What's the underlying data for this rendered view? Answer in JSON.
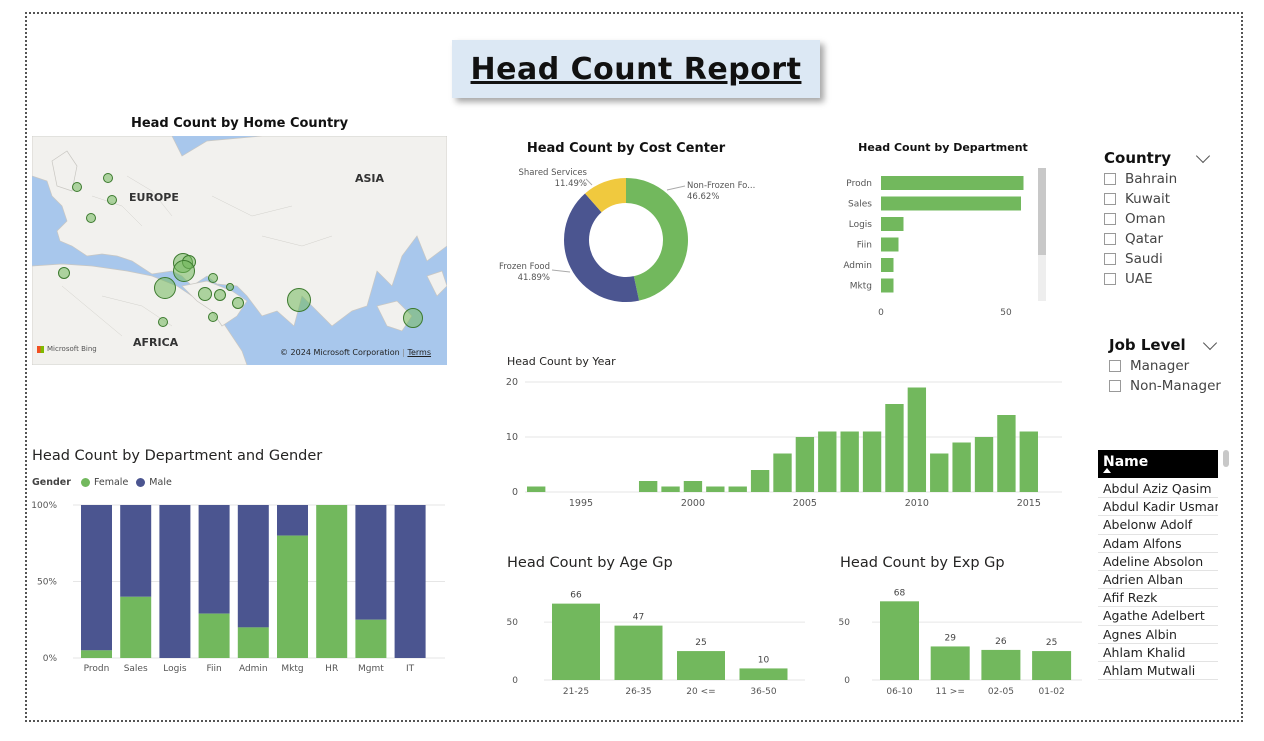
{
  "report": {
    "title": "Head Count Report"
  },
  "colors": {
    "green": "#72b85d",
    "navy": "#4b5590",
    "yellow": "#f0c93e",
    "map_water": "#a8c7ec",
    "map_land": "#f2f1ee"
  },
  "map_visual": {
    "title": "Head Count by Home Country",
    "labels": {
      "europe": "EUROPE",
      "asia": "ASIA",
      "africa": "AFRICA"
    },
    "attribution": "© 2024 Microsoft Corporation",
    "terms": "Terms",
    "logo_text": "Microsoft Bing"
  },
  "chart_data": [
    {
      "id": "cost_center",
      "type": "pie",
      "title": "Head Count by Cost Center",
      "categories": [
        "Non-Frozen Fo...",
        "Frozen Food",
        "Shared Services"
      ],
      "values": [
        46.62,
        41.89,
        11.49
      ],
      "labels": [
        "46.62%",
        "41.89%",
        "11.49%"
      ]
    },
    {
      "id": "department",
      "type": "bar",
      "orientation": "horizontal",
      "title": "Head Count by Department",
      "categories": [
        "Prodn",
        "Sales",
        "Logis",
        "Fiin",
        "Admin",
        "Mktg"
      ],
      "values": [
        57,
        56,
        9,
        7,
        5,
        5
      ],
      "xticks": [
        "0",
        "50"
      ],
      "xlim": [
        0,
        60
      ]
    },
    {
      "id": "year",
      "type": "bar",
      "title": "Head Count by Year",
      "x": [
        1993,
        1994,
        1995,
        1996,
        1997,
        1998,
        1999,
        2000,
        2001,
        2002,
        2003,
        2004,
        2005,
        2006,
        2007,
        2008,
        2009,
        2010,
        2011,
        2012,
        2013,
        2014,
        2015
      ],
      "values": [
        1,
        0,
        0,
        0,
        0,
        2,
        1,
        2,
        1,
        1,
        4,
        7,
        10,
        11,
        11,
        11,
        16,
        19,
        7,
        9,
        10,
        14,
        11
      ],
      "xticks": [
        "1995",
        "2000",
        "2005",
        "2010",
        "2015"
      ],
      "yticks": [
        "0",
        "10",
        "20"
      ],
      "ylim": [
        0,
        20
      ]
    },
    {
      "id": "dept_gender",
      "type": "bar",
      "stacked": "100%",
      "title": "Head Count by Department and Gender",
      "legend_title": "Gender",
      "categories": [
        "Prodn",
        "Sales",
        "Logis",
        "Fiin",
        "Admin",
        "Mktg",
        "HR",
        "Mgmt",
        "IT"
      ],
      "series": [
        {
          "name": "Female",
          "values": [
            5,
            40,
            0,
            29,
            20,
            80,
            100,
            25,
            0
          ]
        },
        {
          "name": "Male",
          "values": [
            95,
            60,
            100,
            71,
            80,
            20,
            0,
            75,
            100
          ]
        }
      ],
      "yticks": [
        "0%",
        "50%",
        "100%"
      ],
      "ylim": [
        0,
        100
      ]
    },
    {
      "id": "age_gp",
      "type": "bar",
      "title": "Head Count by Age Gp",
      "categories": [
        "21-25",
        "26-35",
        "20 <=",
        "36-50"
      ],
      "values": [
        66,
        47,
        25,
        10
      ],
      "yticks": [
        "0",
        "50"
      ],
      "ylim": [
        0,
        70
      ]
    },
    {
      "id": "exp_gp",
      "type": "bar",
      "title": "Head Count by Exp Gp",
      "categories": [
        "06-10",
        "11 >=",
        "02-05",
        "01-02"
      ],
      "values": [
        68,
        29,
        26,
        25
      ],
      "yticks": [
        "0",
        "50"
      ],
      "ylim": [
        0,
        70
      ]
    }
  ],
  "slicers": {
    "country": {
      "title": "Country",
      "items": [
        "Bahrain",
        "Kuwait",
        "Oman",
        "Qatar",
        "Saudi",
        "UAE"
      ]
    },
    "job_level": {
      "title": "Job Level",
      "items": [
        "Manager",
        "Non-Manager"
      ]
    }
  },
  "name_table": {
    "header": "Name",
    "rows": [
      "Abdul Aziz Qasim",
      "Abdul Kadir Usman",
      "Abelonw Adolf",
      "Adam Alfons",
      "Adeline Absolon",
      "Adrien Alban",
      "Afif Rezk",
      "Agathe   Adelbert",
      "Agnes Albin",
      "Ahlam Khalid",
      "Ahlam Mutwali"
    ]
  }
}
